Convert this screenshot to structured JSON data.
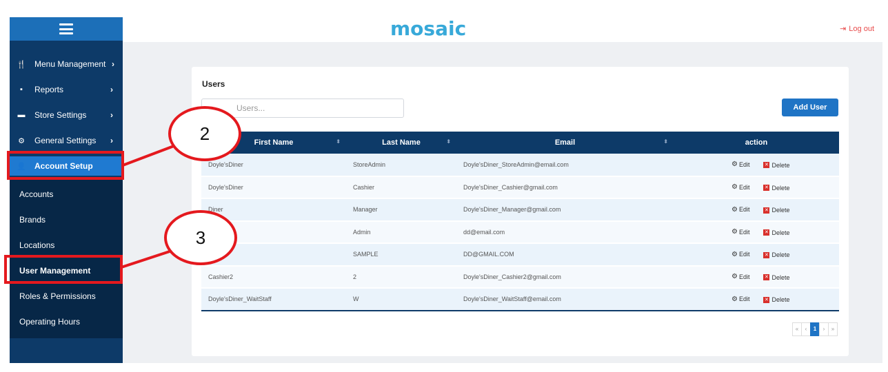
{
  "header": {
    "logo": "mosaic",
    "logout_label": "Log out"
  },
  "sidebar": {
    "items": [
      {
        "label": "Menu Management",
        "icon": "utensils-icon"
      },
      {
        "label": "Reports",
        "icon": "file-icon"
      },
      {
        "label": "Store Settings",
        "icon": "store-icon"
      },
      {
        "label": "General Settings",
        "icon": "gear-icon"
      },
      {
        "label": "Account Setup",
        "icon": "user-icon"
      }
    ],
    "subitems": [
      "Accounts",
      "Brands",
      "Locations",
      "User Management",
      "Roles & Permissions",
      "Operating Hours"
    ]
  },
  "card": {
    "title": "Users",
    "search_placeholder": "Users...",
    "add_button": "Add User",
    "columns": [
      "First Name",
      "Last Name",
      "Email",
      "action"
    ],
    "rows": [
      {
        "first": "Doyle'sDiner",
        "last": "StoreAdmin",
        "email": "Doyle'sDiner_StoreAdmin@email.com"
      },
      {
        "first": "Doyle'sDiner",
        "last": "Cashier",
        "email": "Doyle'sDiner_Cashier@gmail.com"
      },
      {
        "first": "Diner",
        "last": "Manager",
        "email": "Doyle'sDiner_Manager@gmail.com"
      },
      {
        "first": "",
        "last": "Admin",
        "email": "dd@email.com"
      },
      {
        "first": "",
        "last": "SAMPLE",
        "email": "DD@GMAIL.COM"
      },
      {
        "first": "Cashier2",
        "last": "2",
        "email": "Doyle'sDiner_Cashier2@gmail.com"
      },
      {
        "first": "Doyle'sDiner_WaitStaff",
        "last": "W",
        "email": "Doyle'sDiner_WaitStaff@email.com"
      }
    ],
    "edit_label": "Edit",
    "delete_label": "Delete",
    "pagination": {
      "first": "«",
      "prev": "‹",
      "current": "1",
      "next": "›",
      "last": "»"
    }
  },
  "annotations": {
    "callout_2": "2",
    "callout_3": "3",
    "highlight_color": "#e4191e"
  }
}
